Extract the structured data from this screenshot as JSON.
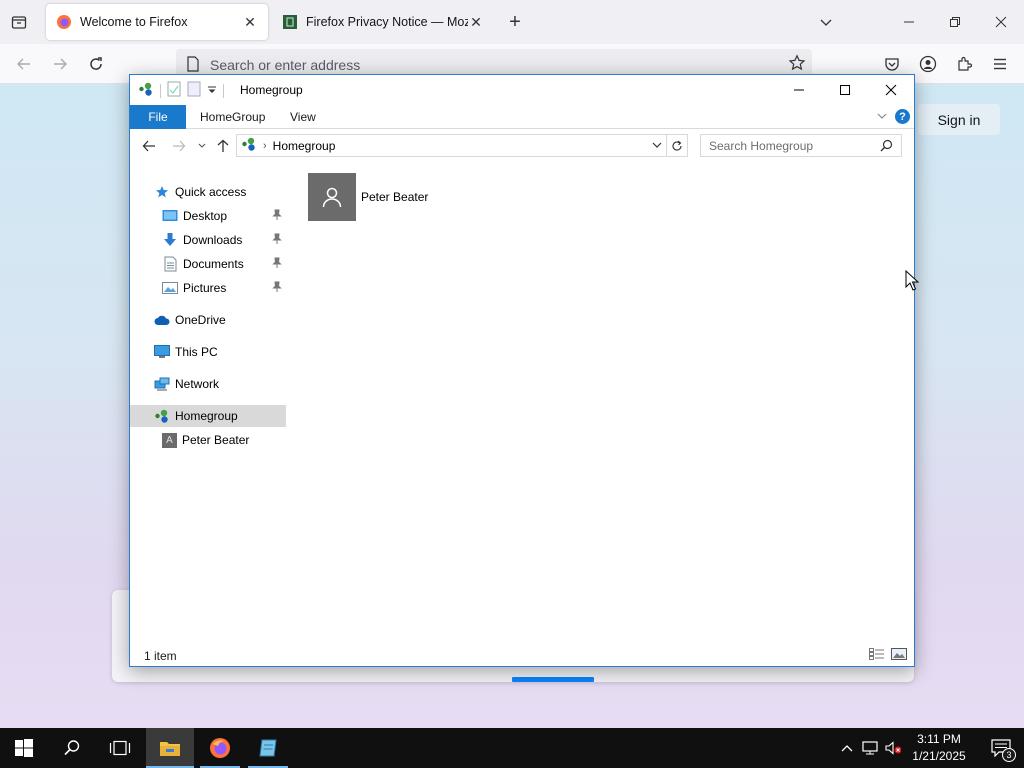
{
  "browser": {
    "tabs": [
      {
        "title": "Welcome to Firefox",
        "active": true
      },
      {
        "title": "Firefox Privacy Notice — Mozill",
        "active": false
      }
    ],
    "url_placeholder": "Search or enter address",
    "sign_in_label": "Sign in"
  },
  "explorer": {
    "title": "Homegroup",
    "ribbon_tabs": [
      "File",
      "HomeGroup",
      "View"
    ],
    "breadcrumb": [
      "Homegroup"
    ],
    "search_placeholder": "Search Homegroup",
    "nav": {
      "quick_access": "Quick access",
      "pinned": [
        "Desktop",
        "Downloads",
        "Documents",
        "Pictures"
      ],
      "onedrive": "OneDrive",
      "this_pc": "This PC",
      "network": "Network",
      "homegroup": "Homegroup",
      "member": "Peter Beater",
      "member_initial": "A"
    },
    "items": [
      {
        "name": "Peter Beater",
        "icon": "user-avatar-icon"
      }
    ],
    "status": "1 item"
  },
  "taskbar": {
    "time": "3:11 PM",
    "date": "1/21/2025",
    "notification_count": "3"
  },
  "colors": {
    "accent": "#1979ca",
    "firefox_blue": "#0a84ff",
    "taskbar": "#101010"
  }
}
